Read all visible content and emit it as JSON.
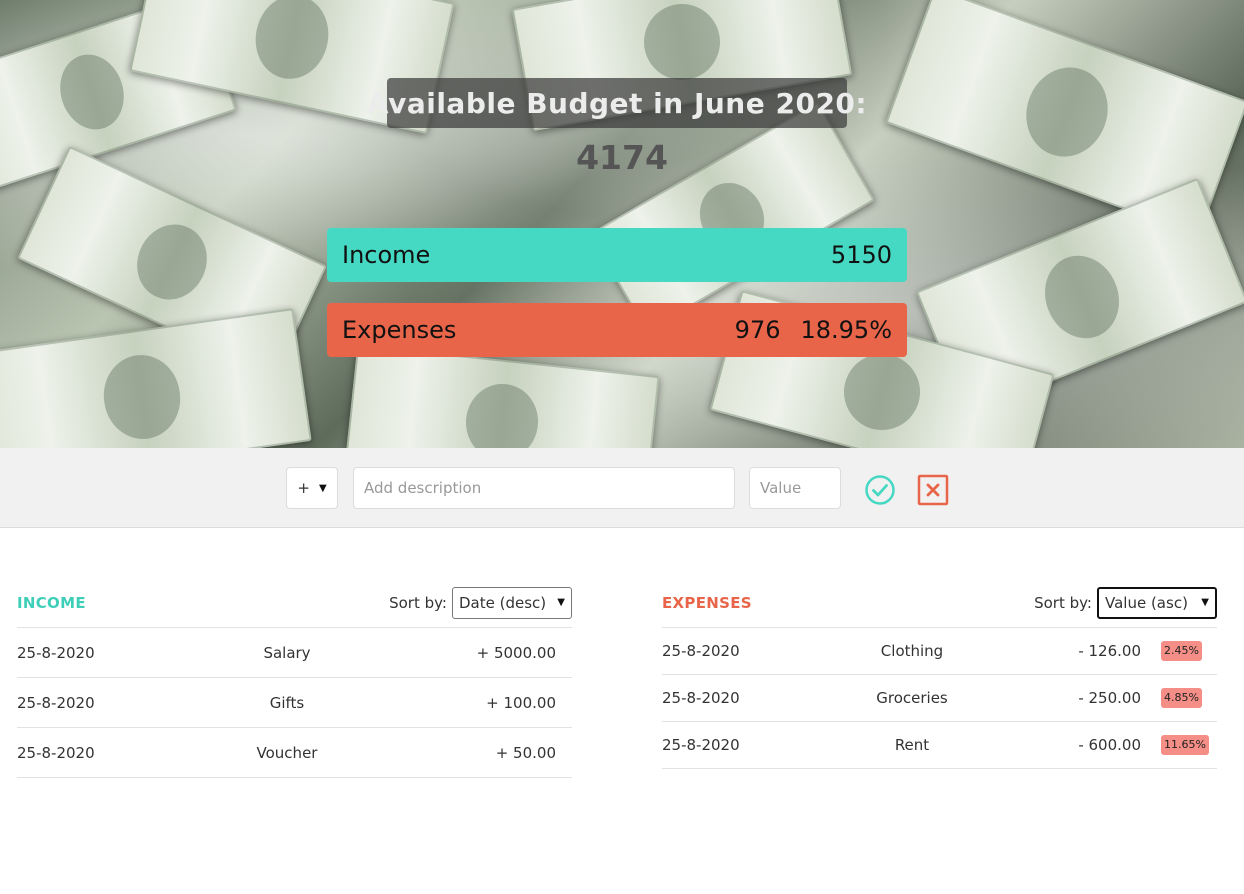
{
  "header": {
    "budget_title": "Available Budget in June 2020:",
    "budget_value": "4174",
    "income_label": "Income",
    "income_value": "5150",
    "expenses_label": "Expenses",
    "expenses_value": "976",
    "expenses_percentage": "18.95%"
  },
  "add_form": {
    "type_value": "+",
    "description_placeholder": "Add description",
    "value_placeholder": "Value"
  },
  "income": {
    "title": "INCOME",
    "sort_label": "Sort by:",
    "sort_value": "Date (desc)",
    "items": [
      {
        "date": "25-8-2020",
        "description": "Salary",
        "amount": "+ 5000.00"
      },
      {
        "date": "25-8-2020",
        "description": "Gifts",
        "amount": "+ 100.00"
      },
      {
        "date": "25-8-2020",
        "description": "Voucher",
        "amount": "+ 50.00"
      }
    ]
  },
  "expenses": {
    "title": "EXPENSES",
    "sort_label": "Sort by:",
    "sort_value": "Value (asc)",
    "items": [
      {
        "date": "25-8-2020",
        "description": "Clothing",
        "amount": "- 126.00",
        "percentage": "2.45%"
      },
      {
        "date": "25-8-2020",
        "description": "Groceries",
        "amount": "- 250.00",
        "percentage": "4.85%"
      },
      {
        "date": "25-8-2020",
        "description": "Rent",
        "amount": "- 600.00",
        "percentage": "11.65%"
      }
    ]
  },
  "colors": {
    "income_accent": "#45d8c2",
    "expense_accent": "#e8654a",
    "percentage_badge": "#f48e86"
  }
}
